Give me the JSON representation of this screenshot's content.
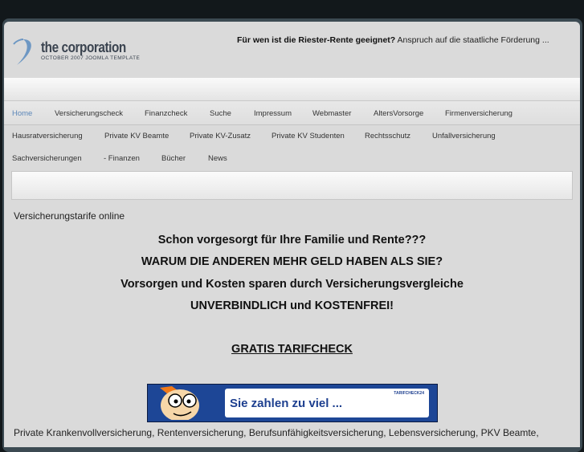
{
  "header": {
    "brand": "the corporation",
    "tagline": "OCTOBER 2007 JOOMLA TEMPLATE",
    "news_bold": "Für wen ist die Riester-Rente geeignet?",
    "news_text": " Anspruch auf die staatliche Förderung ..."
  },
  "nav": {
    "row1": [
      "Home",
      "Versicherungscheck",
      "Finanzcheck",
      "Suche",
      "Impressum",
      "Webmaster",
      "AltersVorsorge",
      "Firmenversicherung"
    ],
    "row2": [
      "Hausratversicherung",
      "Private KV Beamte",
      "Private KV-Zusatz",
      "Private KV Studenten",
      "Rechtsschutz",
      "Unfallversicherung"
    ],
    "row3": [
      "Sachversicherungen",
      "- Finanzen",
      "Bücher",
      "News"
    ]
  },
  "main": {
    "subtitle": "Versicherungstarife online",
    "headlines": [
      "Schon vorgesorgt für Ihre Familie und Rente???",
      "WARUM DIE ANDEREN MEHR GELD HABEN ALS SIE?",
      "Vorsorgen und Kosten sparen durch Versicherungsvergleiche",
      "UNVERBINDLICH und KOSTENFREI!"
    ],
    "cta": "GRATIS TARIFCHECK",
    "banner": {
      "text": "Sie zahlen zu viel ...",
      "logo": "TARIFCHECK24"
    },
    "bottom_text": "Private Krankenvollversicherung, Rentenversicherung, Berufsunfähigkeitsversicherung, Lebensversicherung, PKV Beamte,"
  },
  "colors": {
    "active_nav": "#5b86b8",
    "banner_bg": "#1d4696"
  }
}
